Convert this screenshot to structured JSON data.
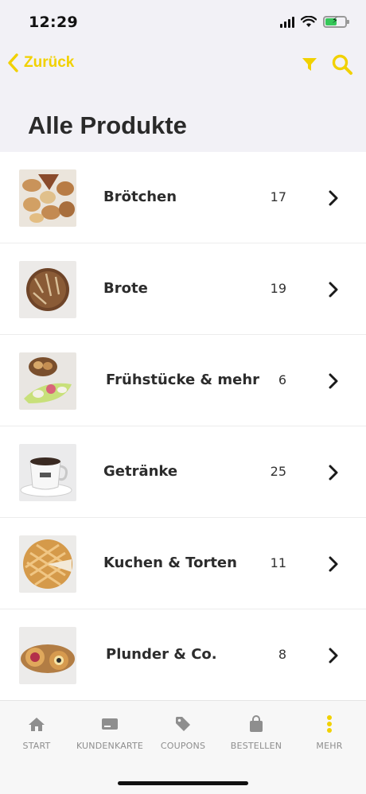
{
  "status": {
    "time": "12:29"
  },
  "nav": {
    "back_label": "Zurück"
  },
  "page": {
    "title": "Alle Produkte"
  },
  "colors": {
    "accent": "#f1d100",
    "tab_inactive": "#8e8e8e"
  },
  "categories": [
    {
      "label": "Brötchen",
      "count": "17"
    },
    {
      "label": "Brote",
      "count": "19"
    },
    {
      "label": "Frühstücke & mehr",
      "count": "6"
    },
    {
      "label": "Getränke",
      "count": "25"
    },
    {
      "label": "Kuchen & Torten",
      "count": "11"
    },
    {
      "label": "Plunder & Co.",
      "count": "8"
    }
  ],
  "tabs": [
    {
      "label": "START",
      "icon": "home-icon"
    },
    {
      "label": "KUNDENKARTE",
      "icon": "card-icon"
    },
    {
      "label": "COUPONS",
      "icon": "tag-icon"
    },
    {
      "label": "BESTELLEN",
      "icon": "bag-icon"
    },
    {
      "label": "MEHR",
      "icon": "more-icon"
    }
  ]
}
